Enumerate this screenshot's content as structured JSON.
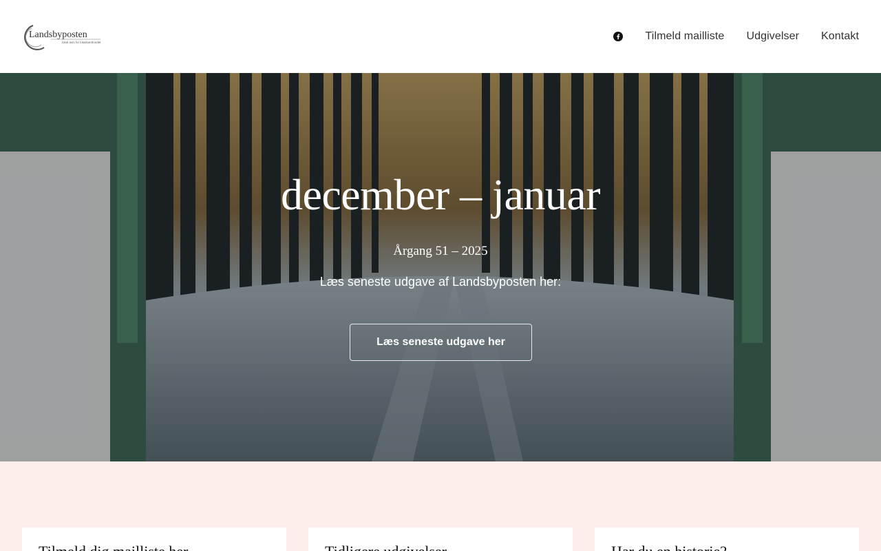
{
  "header": {
    "logo_text": "Landsbyposten",
    "logo_tagline": "lokal avis for lokalsamfundet",
    "nav": [
      {
        "label": "Tilmeld mailliste"
      },
      {
        "label": "Udgivelser"
      },
      {
        "label": "Kontakt"
      }
    ],
    "facebook_icon": "facebook-icon"
  },
  "hero": {
    "title": "december – januar",
    "subtitle": "Årgang 51 – 2025",
    "lead": "Læs seneste udgave af Landsbyposten her:",
    "button_label": "Læs seneste udgave her",
    "accent_color": "#3e6a56"
  },
  "cards": [
    {
      "title": "Tilmeld dig mailliste her"
    },
    {
      "title": "Tidligere udgivelser"
    },
    {
      "title": "Har du en historie?"
    }
  ],
  "colors": {
    "section_bg": "#fdeeeb",
    "header_bg": "#ffffff"
  }
}
